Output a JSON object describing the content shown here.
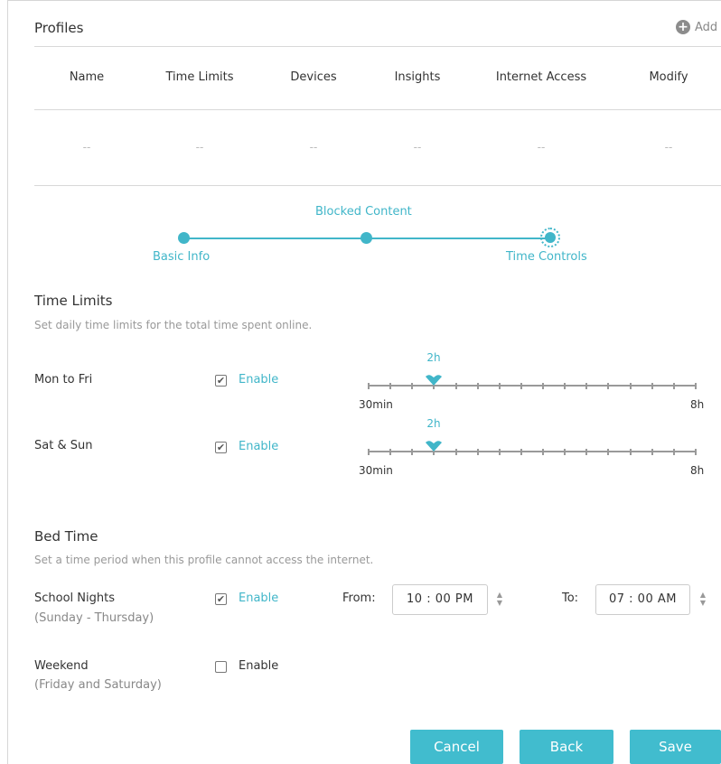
{
  "profiles": {
    "title": "Profiles",
    "add_label": "Add",
    "columns": [
      "Name",
      "Time Limits",
      "Devices",
      "Insights",
      "Internet Access",
      "Modify"
    ],
    "row": [
      "--",
      "--",
      "--",
      "--",
      "--",
      "--"
    ]
  },
  "steps": {
    "items": [
      {
        "label": "Basic Info",
        "state": "done"
      },
      {
        "label": "Blocked Content",
        "state": "done"
      },
      {
        "label": "Time Controls",
        "state": "active"
      }
    ]
  },
  "time_limits": {
    "title": "Time Limits",
    "description": "Set daily time limits for the total time spent online.",
    "rows": [
      {
        "label": "Mon to Fri",
        "enable_label": "Enable",
        "enabled": true,
        "value_label": "2h",
        "min_label": "30min",
        "max_label": "8h",
        "value_hours": 2
      },
      {
        "label": "Sat & Sun",
        "enable_label": "Enable",
        "enabled": true,
        "value_label": "2h",
        "min_label": "30min",
        "max_label": "8h",
        "value_hours": 2
      }
    ]
  },
  "bed_time": {
    "title": "Bed Time",
    "description": "Set a time period when this profile cannot access the internet.",
    "rows": [
      {
        "label": "School Nights",
        "sub": "(Sunday - Thursday)",
        "enable_label": "Enable",
        "enabled": true,
        "from_label": "From:",
        "from_value": "10 : 00  PM",
        "to_label": "To:",
        "to_value": "07 : 00  AM"
      },
      {
        "label": "Weekend",
        "sub": "(Friday and Saturday)",
        "enable_label": "Enable",
        "enabled": false
      }
    ]
  },
  "buttons": {
    "cancel": "Cancel",
    "back": "Back",
    "save": "Save"
  },
  "colors": {
    "accent": "#41bcce",
    "step": "#41b6c9"
  }
}
